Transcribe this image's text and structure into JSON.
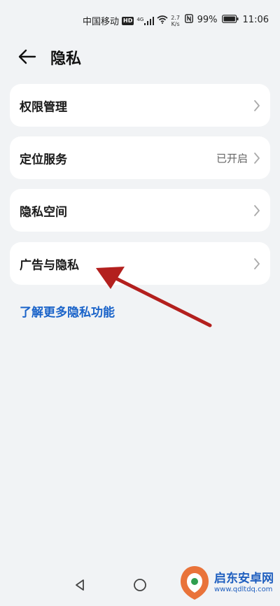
{
  "status_bar": {
    "carrier": "中国移动",
    "hd_badge": "HD",
    "signal_type": "4G",
    "net_speed_value": "2.7",
    "net_speed_unit": "K/s",
    "nfc_icon": "nfc-icon",
    "battery_percent": "99%",
    "time": "11:06"
  },
  "header": {
    "title": "隐私",
    "back_icon": "arrow-left-icon"
  },
  "menu": {
    "items": [
      {
        "label": "权限管理",
        "value": ""
      },
      {
        "label": "定位服务",
        "value": "已开启"
      },
      {
        "label": "隐私空间",
        "value": ""
      },
      {
        "label": "广告与隐私",
        "value": ""
      }
    ]
  },
  "more_link": "了解更多隐私功能",
  "watermark": {
    "name": "启东安卓网",
    "url": "www.qdltdq.com"
  },
  "colors": {
    "background": "#f1f3f5",
    "card": "#ffffff",
    "link": "#1a63c9",
    "annotation_arrow": "#b3201e"
  }
}
